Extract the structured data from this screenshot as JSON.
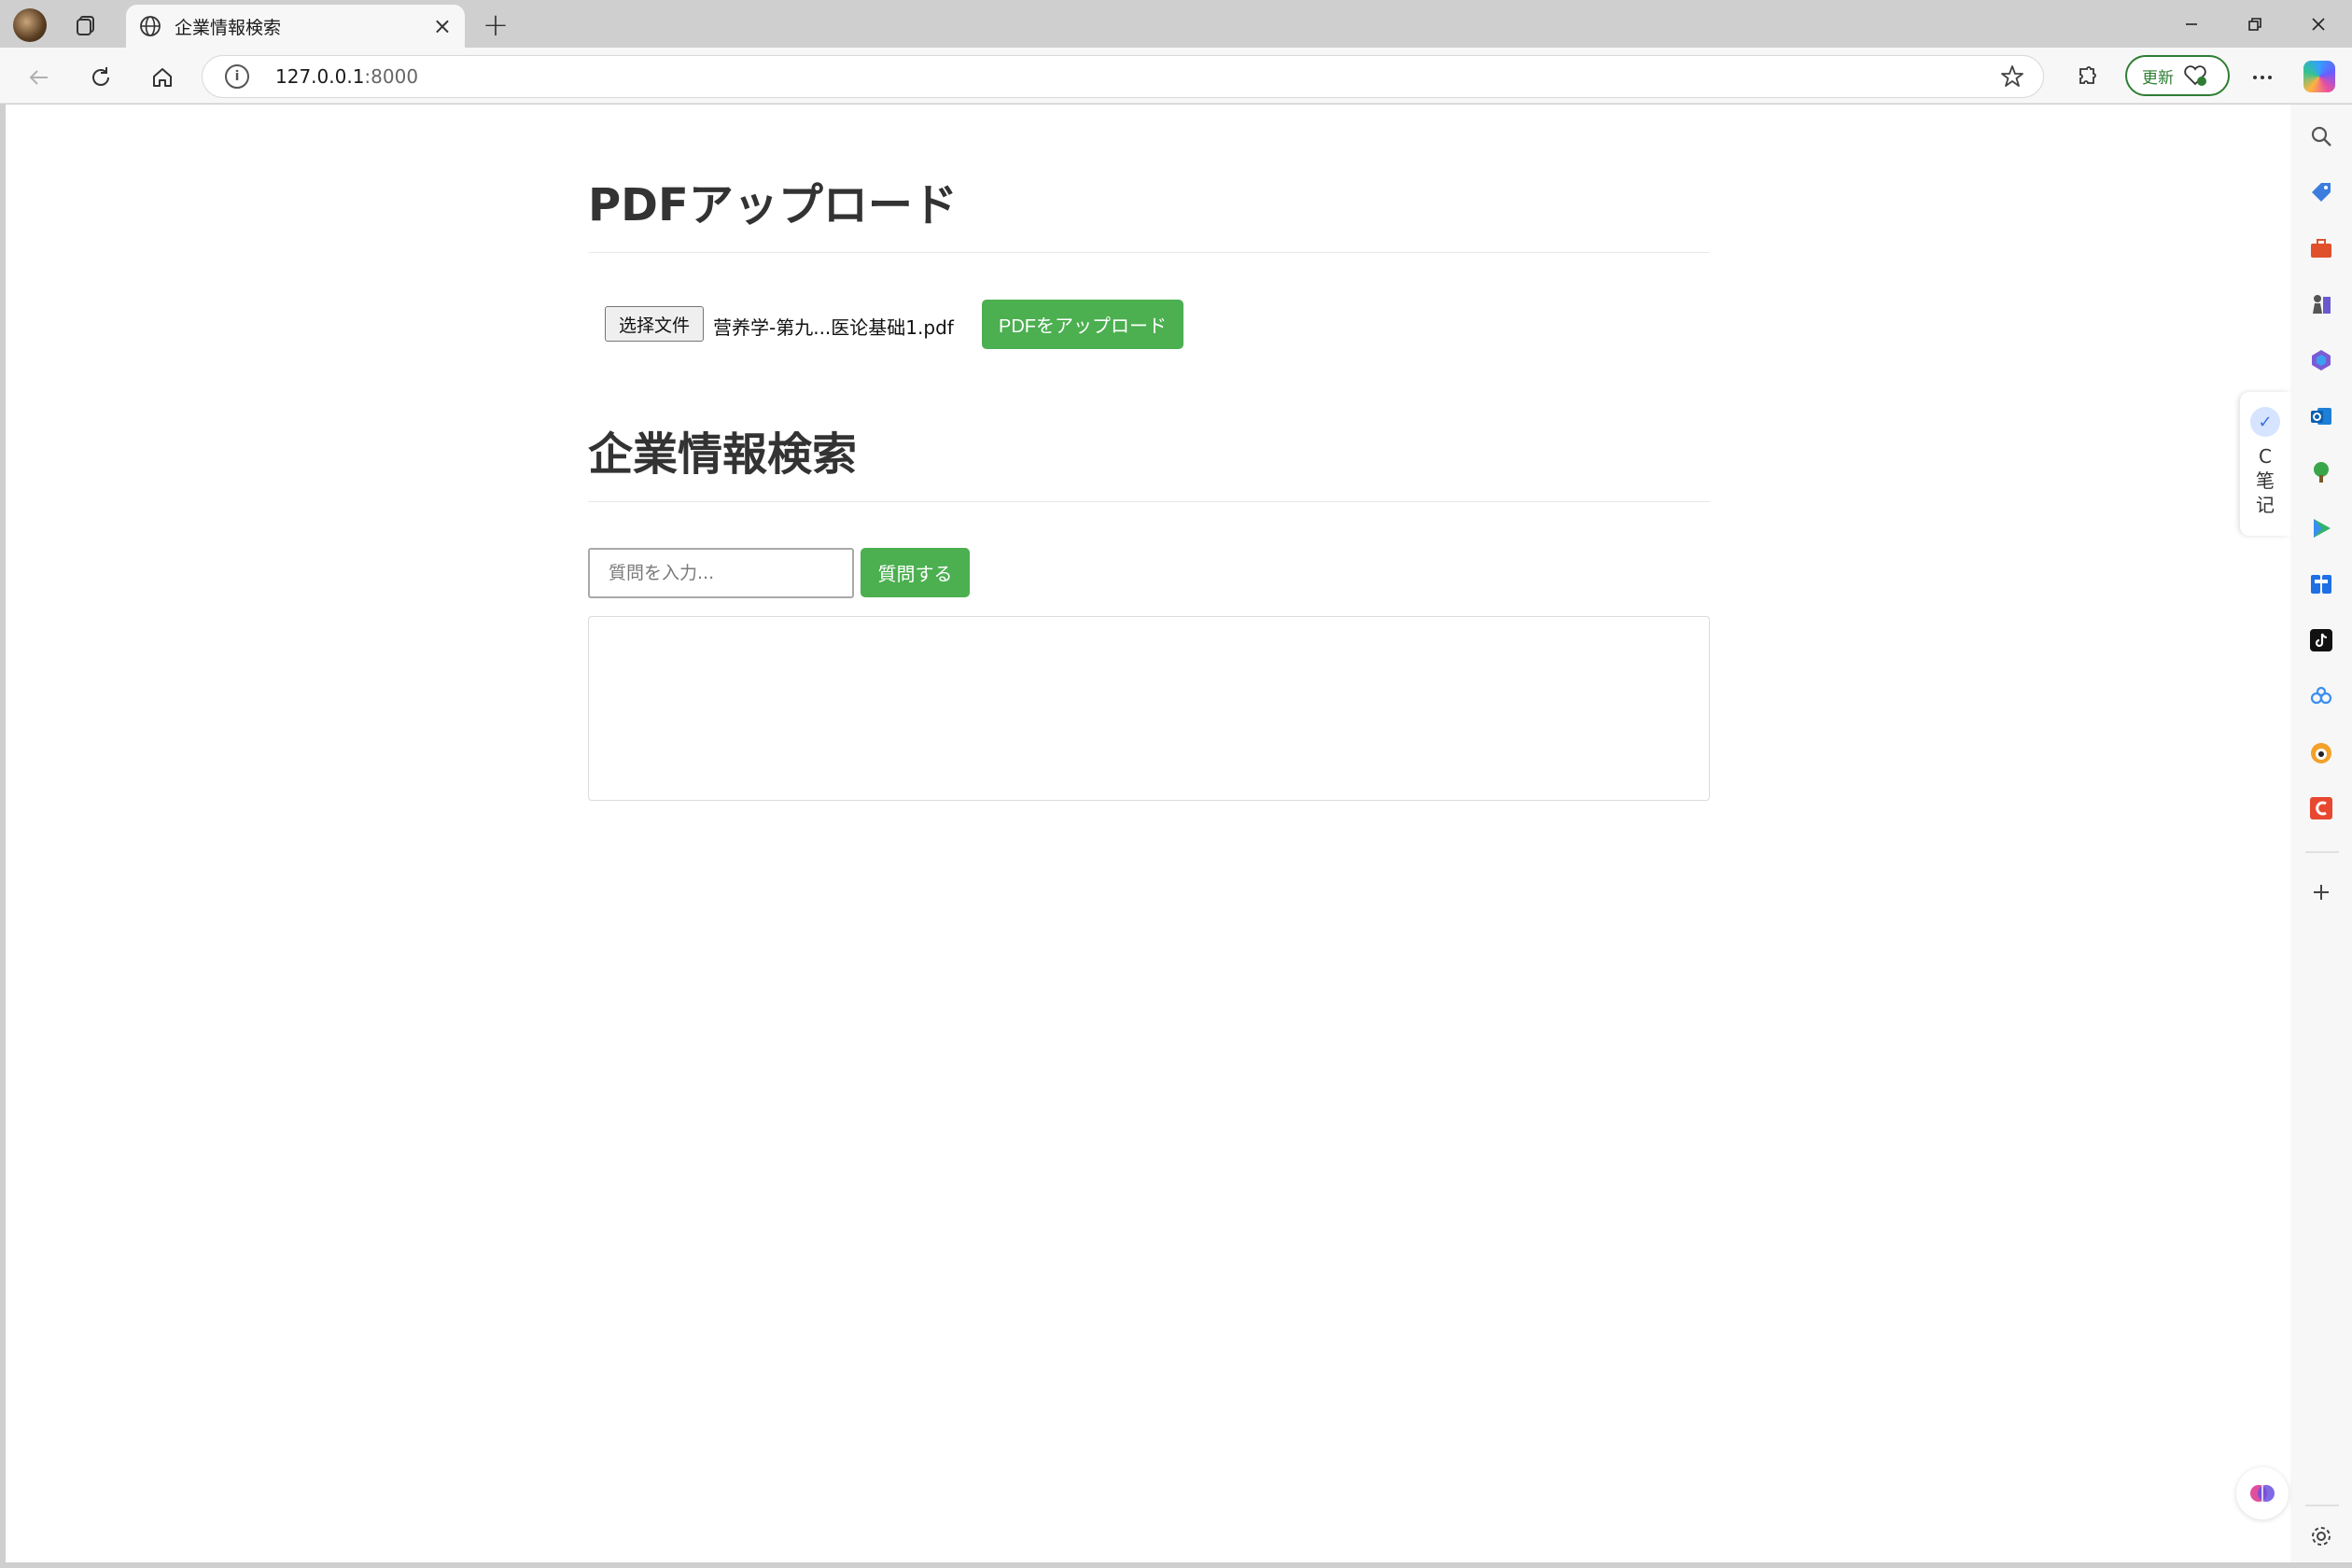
{
  "browser": {
    "tab_title": "企業情報検索",
    "url_host": "127.0.0.1",
    "url_port": ":8000",
    "update_label": "更新",
    "note_label": "C笔记",
    "info_glyph": "i",
    "new_tab_glyph": "+",
    "close_tab_glyph": "×"
  },
  "upload_section": {
    "heading": "PDFアップロード",
    "choose_file_label": "选择文件",
    "file_name": "营养学-第九...医论基础1.pdf",
    "upload_button_label": "PDFをアップロード"
  },
  "search_section": {
    "heading": "企業情報検索",
    "query_placeholder": "質問を入力...",
    "query_value": "",
    "ask_button_label": "質問する",
    "result_text": ""
  },
  "colors": {
    "accent_green": "#4caf50",
    "update_green": "#2e7d32"
  },
  "sidebar_icons": [
    "search-icon",
    "tag-icon",
    "toolbox-icon",
    "chess-icon",
    "m365-icon",
    "outlook-icon",
    "tree-icon",
    "play-icon",
    "translate-icon",
    "tiktok-icon",
    "link-icon",
    "game-icon",
    "c-icon",
    "add-icon",
    "settings-icon"
  ]
}
